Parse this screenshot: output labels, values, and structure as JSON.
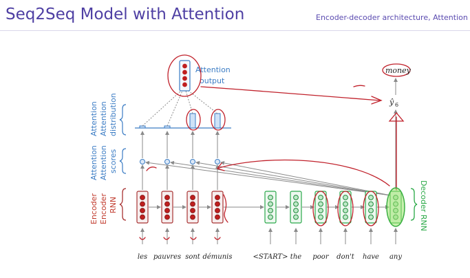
{
  "slide": {
    "title": "Seq2Seq Model with Attention",
    "subtitle": "Encoder-decoder architecture, Attention"
  },
  "labels": {
    "attention_output_line1": "Attention",
    "attention_output_line2": "output",
    "attention_distribution_line1": "Attention",
    "attention_distribution_line2": "distribution",
    "attention_scores_line1": "Attention",
    "attention_scores_line2": "scores",
    "encoder_rnn_line1": "Encoder",
    "encoder_rnn_line2": "RNN",
    "decoder_rnn": "Decoder RNN",
    "handwritten_prediction": "money",
    "output_symbol": "ŷ",
    "output_subscript": "6"
  },
  "encoder_words": [
    "les",
    "pauvres",
    "sont",
    "démunis"
  ],
  "decoder_words": [
    "<START>",
    "the",
    "poor",
    "don't",
    "have",
    "any"
  ],
  "colors": {
    "title": "#4e3fa3",
    "encoder": "#a83232",
    "decoder": "#2aa84a",
    "attention": "#3b7cc4",
    "annotation": "#c0202a",
    "highlight": "#9be36b"
  }
}
